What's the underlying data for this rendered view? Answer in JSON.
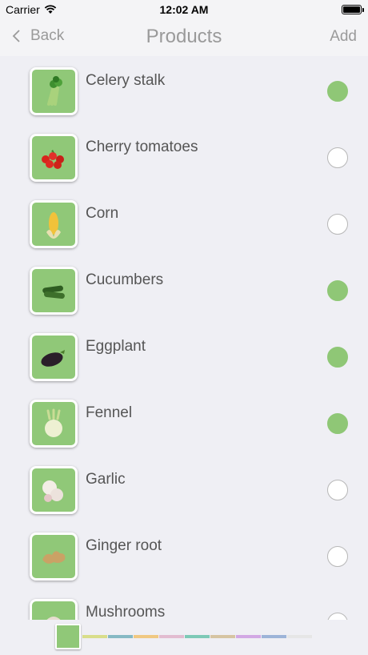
{
  "status_bar": {
    "carrier": "Carrier",
    "time": "12:02 AM"
  },
  "nav": {
    "back_label": "Back",
    "title": "Products",
    "add_label": "Add"
  },
  "products": [
    {
      "name": "Celery stalk",
      "icon": "celery-icon",
      "selected": true
    },
    {
      "name": "Cherry tomatoes",
      "icon": "cherry-tomatoes-icon",
      "selected": false
    },
    {
      "name": "Corn",
      "icon": "corn-icon",
      "selected": false
    },
    {
      "name": "Cucumbers",
      "icon": "cucumbers-icon",
      "selected": true
    },
    {
      "name": "Eggplant",
      "icon": "eggplant-icon",
      "selected": true
    },
    {
      "name": "Fennel",
      "icon": "fennel-icon",
      "selected": true
    },
    {
      "name": "Garlic",
      "icon": "garlic-icon",
      "selected": false
    },
    {
      "name": "Ginger root",
      "icon": "ginger-icon",
      "selected": false
    },
    {
      "name": "Mushrooms",
      "icon": "mushroom-icon",
      "selected": false
    }
  ],
  "colors": {
    "accent_green": "#90c878",
    "check_on": "#8fc776",
    "swatches": [
      "#d9de8a",
      "#86b9c4",
      "#f0c882",
      "#e2bcd0",
      "#7ec9b6",
      "#d6c4a2",
      "#d2a8e4",
      "#9db4d8",
      "#e6e6e6"
    ]
  }
}
